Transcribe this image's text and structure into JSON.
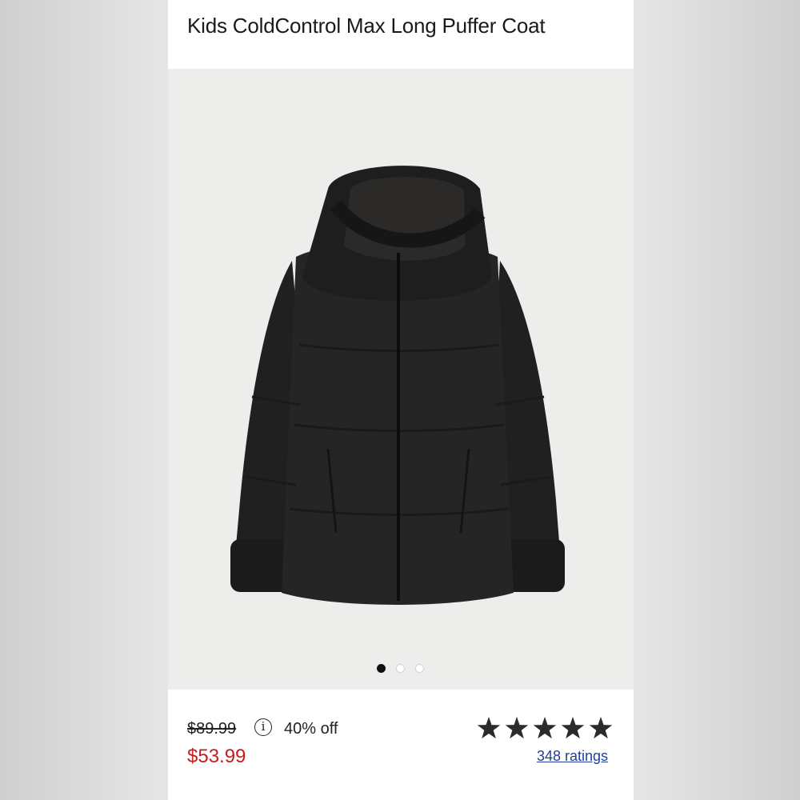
{
  "product": {
    "title": "Kids ColdControl Max Long Puffer Coat",
    "image_icon": "puffer-coat-photo",
    "carousel": {
      "count": 3,
      "active_index": 0
    }
  },
  "pricing": {
    "original_price": "$89.99",
    "info_icon": "i",
    "discount": "40% off",
    "sale_price": "$53.99"
  },
  "rating": {
    "stars": 5,
    "max_stars": 5,
    "ratings_text": "348 ratings"
  },
  "colors": {
    "sale_price": "#cc1a1a",
    "link": "#1f3f9a",
    "image_bg": "#ededeb"
  }
}
